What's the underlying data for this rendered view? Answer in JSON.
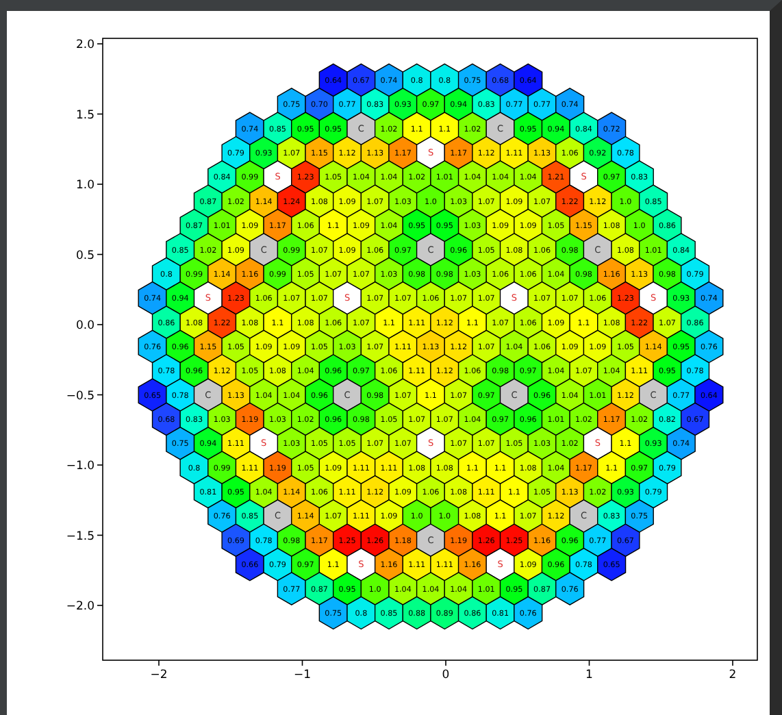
{
  "plot": {
    "y_ticks": [
      "2.0",
      "1.5",
      "1.0",
      "0.5",
      "0.0",
      "−0.5",
      "−1.0",
      "−1.5",
      "−2.0"
    ],
    "x_ticks": [
      "−2",
      "−1",
      "0",
      "1",
      "2"
    ],
    "rows": [
      {
        "cells": [
          {
            "kind": "value",
            "text": "0.64"
          },
          {
            "kind": "value",
            "text": "0.67"
          },
          {
            "kind": "value",
            "text": "0.74"
          },
          {
            "kind": "value",
            "text": "0.8"
          },
          {
            "kind": "value",
            "text": "0.8"
          },
          {
            "kind": "value",
            "text": "0.75"
          },
          {
            "kind": "value",
            "text": "0.68"
          },
          {
            "kind": "value",
            "text": "0.64"
          }
        ]
      },
      {
        "cells": [
          {
            "kind": "value",
            "text": "0.75"
          },
          {
            "kind": "value",
            "text": "0.70"
          },
          {
            "kind": "value",
            "text": "0.77"
          },
          {
            "kind": "value",
            "text": "0.83"
          },
          {
            "kind": "value",
            "text": "0.93"
          },
          {
            "kind": "value",
            "text": "0.97"
          },
          {
            "kind": "value",
            "text": "0.94"
          },
          {
            "kind": "value",
            "text": "0.83"
          },
          {
            "kind": "value",
            "text": "0.77"
          },
          {
            "kind": "value",
            "text": "0.77"
          },
          {
            "kind": "value",
            "text": "0.74"
          }
        ]
      },
      {
        "cells": [
          {
            "kind": "value",
            "text": "0.74"
          },
          {
            "kind": "value",
            "text": "0.85"
          },
          {
            "kind": "value",
            "text": "0.95"
          },
          {
            "kind": "value",
            "text": "0.95"
          },
          {
            "kind": "control",
            "text": "C"
          },
          {
            "kind": "value",
            "text": "1.02"
          },
          {
            "kind": "value",
            "text": "1.1"
          },
          {
            "kind": "value",
            "text": "1.1"
          },
          {
            "kind": "value",
            "text": "1.02"
          },
          {
            "kind": "control",
            "text": "C"
          },
          {
            "kind": "value",
            "text": "0.95"
          },
          {
            "kind": "value",
            "text": "0.94"
          },
          {
            "kind": "value",
            "text": "0.84"
          },
          {
            "kind": "value",
            "text": "0.72"
          }
        ]
      },
      {
        "cells": [
          {
            "kind": "value",
            "text": "0.79"
          },
          {
            "kind": "value",
            "text": "0.93"
          },
          {
            "kind": "value",
            "text": "1.07"
          },
          {
            "kind": "value",
            "text": "1.15"
          },
          {
            "kind": "value",
            "text": "1.12"
          },
          {
            "kind": "value",
            "text": "1.13"
          },
          {
            "kind": "value",
            "text": "1.17"
          },
          {
            "kind": "source",
            "text": "S"
          },
          {
            "kind": "value",
            "text": "1.17"
          },
          {
            "kind": "value",
            "text": "1.12"
          },
          {
            "kind": "value",
            "text": "1.11"
          },
          {
            "kind": "value",
            "text": "1.13"
          },
          {
            "kind": "value",
            "text": "1.06"
          },
          {
            "kind": "value",
            "text": "0.92"
          },
          {
            "kind": "value",
            "text": "0.78"
          }
        ]
      },
      {
        "cells": [
          {
            "kind": "value",
            "text": "0.84"
          },
          {
            "kind": "value",
            "text": "0.99"
          },
          {
            "kind": "source",
            "text": "S"
          },
          {
            "kind": "value",
            "text": "1.23"
          },
          {
            "kind": "value",
            "text": "1.05"
          },
          {
            "kind": "value",
            "text": "1.04"
          },
          {
            "kind": "value",
            "text": "1.04"
          },
          {
            "kind": "value",
            "text": "1.02"
          },
          {
            "kind": "value",
            "text": "1.01"
          },
          {
            "kind": "value",
            "text": "1.04"
          },
          {
            "kind": "value",
            "text": "1.04"
          },
          {
            "kind": "value",
            "text": "1.04"
          },
          {
            "kind": "value",
            "text": "1.21"
          },
          {
            "kind": "source",
            "text": "S"
          },
          {
            "kind": "value",
            "text": "0.97"
          },
          {
            "kind": "value",
            "text": "0.83"
          }
        ]
      },
      {
        "cells": [
          {
            "kind": "value",
            "text": "0.87"
          },
          {
            "kind": "value",
            "text": "1.02"
          },
          {
            "kind": "value",
            "text": "1.14"
          },
          {
            "kind": "value",
            "text": "1.24"
          },
          {
            "kind": "value",
            "text": "1.08"
          },
          {
            "kind": "value",
            "text": "1.09"
          },
          {
            "kind": "value",
            "text": "1.07"
          },
          {
            "kind": "value",
            "text": "1.03"
          },
          {
            "kind": "value",
            "text": "1.0"
          },
          {
            "kind": "value",
            "text": "1.03"
          },
          {
            "kind": "value",
            "text": "1.07"
          },
          {
            "kind": "value",
            "text": "1.09"
          },
          {
            "kind": "value",
            "text": "1.07"
          },
          {
            "kind": "value",
            "text": "1.22"
          },
          {
            "kind": "value",
            "text": "1.12"
          },
          {
            "kind": "value",
            "text": "1.0"
          },
          {
            "kind": "value",
            "text": "0.85"
          }
        ]
      },
      {
        "cells": [
          {
            "kind": "value",
            "text": "0.87"
          },
          {
            "kind": "value",
            "text": "1.01"
          },
          {
            "kind": "value",
            "text": "1.09"
          },
          {
            "kind": "value",
            "text": "1.17"
          },
          {
            "kind": "value",
            "text": "1.06"
          },
          {
            "kind": "value",
            "text": "1.1"
          },
          {
            "kind": "value",
            "text": "1.09"
          },
          {
            "kind": "value",
            "text": "1.04"
          },
          {
            "kind": "value",
            "text": "0.95"
          },
          {
            "kind": "value",
            "text": "0.95"
          },
          {
            "kind": "value",
            "text": "1.03"
          },
          {
            "kind": "value",
            "text": "1.09"
          },
          {
            "kind": "value",
            "text": "1.09"
          },
          {
            "kind": "value",
            "text": "1.05"
          },
          {
            "kind": "value",
            "text": "1.15"
          },
          {
            "kind": "value",
            "text": "1.08"
          },
          {
            "kind": "value",
            "text": "1.0"
          },
          {
            "kind": "value",
            "text": "0.86"
          }
        ]
      },
      {
        "cells": [
          {
            "kind": "value",
            "text": "0.85"
          },
          {
            "kind": "value",
            "text": "1.02"
          },
          {
            "kind": "value",
            "text": "1.09"
          },
          {
            "kind": "control",
            "text": "C"
          },
          {
            "kind": "value",
            "text": "0.99"
          },
          {
            "kind": "value",
            "text": "1.07"
          },
          {
            "kind": "value",
            "text": "1.09"
          },
          {
            "kind": "value",
            "text": "1.06"
          },
          {
            "kind": "value",
            "text": "0.97"
          },
          {
            "kind": "control",
            "text": "C"
          },
          {
            "kind": "value",
            "text": "0.96"
          },
          {
            "kind": "value",
            "text": "1.05"
          },
          {
            "kind": "value",
            "text": "1.08"
          },
          {
            "kind": "value",
            "text": "1.06"
          },
          {
            "kind": "value",
            "text": "0.98"
          },
          {
            "kind": "control",
            "text": "C"
          },
          {
            "kind": "value",
            "text": "1.08"
          },
          {
            "kind": "value",
            "text": "1.01"
          },
          {
            "kind": "value",
            "text": "0.84"
          }
        ]
      },
      {
        "cells": [
          {
            "kind": "value",
            "text": "0.8"
          },
          {
            "kind": "value",
            "text": "0.99"
          },
          {
            "kind": "value",
            "text": "1.14"
          },
          {
            "kind": "value",
            "text": "1.16"
          },
          {
            "kind": "value",
            "text": "0.99"
          },
          {
            "kind": "value",
            "text": "1.05"
          },
          {
            "kind": "value",
            "text": "1.07"
          },
          {
            "kind": "value",
            "text": "1.07"
          },
          {
            "kind": "value",
            "text": "1.03"
          },
          {
            "kind": "value",
            "text": "0.98"
          },
          {
            "kind": "value",
            "text": "0.98"
          },
          {
            "kind": "value",
            "text": "1.03"
          },
          {
            "kind": "value",
            "text": "1.06"
          },
          {
            "kind": "value",
            "text": "1.06"
          },
          {
            "kind": "value",
            "text": "1.04"
          },
          {
            "kind": "value",
            "text": "0.98"
          },
          {
            "kind": "value",
            "text": "1.16"
          },
          {
            "kind": "value",
            "text": "1.13"
          },
          {
            "kind": "value",
            "text": "0.98"
          },
          {
            "kind": "value",
            "text": "0.79"
          }
        ]
      },
      {
        "cells": [
          {
            "kind": "value",
            "text": "0.74"
          },
          {
            "kind": "value",
            "text": "0.94"
          },
          {
            "kind": "source",
            "text": "S"
          },
          {
            "kind": "value",
            "text": "1.23"
          },
          {
            "kind": "value",
            "text": "1.06"
          },
          {
            "kind": "value",
            "text": "1.07"
          },
          {
            "kind": "value",
            "text": "1.07"
          },
          {
            "kind": "source",
            "text": "S"
          },
          {
            "kind": "value",
            "text": "1.07"
          },
          {
            "kind": "value",
            "text": "1.07"
          },
          {
            "kind": "value",
            "text": "1.06"
          },
          {
            "kind": "value",
            "text": "1.07"
          },
          {
            "kind": "value",
            "text": "1.07"
          },
          {
            "kind": "source",
            "text": "S"
          },
          {
            "kind": "value",
            "text": "1.07"
          },
          {
            "kind": "value",
            "text": "1.07"
          },
          {
            "kind": "value",
            "text": "1.06"
          },
          {
            "kind": "value",
            "text": "1.23"
          },
          {
            "kind": "source",
            "text": "S"
          },
          {
            "kind": "value",
            "text": "0.93"
          },
          {
            "kind": "value",
            "text": "0.74"
          }
        ]
      },
      {
        "cells": [
          {
            "kind": "value",
            "text": "0.86"
          },
          {
            "kind": "value",
            "text": "1.08"
          },
          {
            "kind": "value",
            "text": "1.22"
          },
          {
            "kind": "value",
            "text": "1.08"
          },
          {
            "kind": "value",
            "text": "1.1"
          },
          {
            "kind": "value",
            "text": "1.08"
          },
          {
            "kind": "value",
            "text": "1.06"
          },
          {
            "kind": "value",
            "text": "1.07"
          },
          {
            "kind": "value",
            "text": "1.1"
          },
          {
            "kind": "value",
            "text": "1.11"
          },
          {
            "kind": "value",
            "text": "1.12"
          },
          {
            "kind": "value",
            "text": "1.1"
          },
          {
            "kind": "value",
            "text": "1.07"
          },
          {
            "kind": "value",
            "text": "1.06"
          },
          {
            "kind": "value",
            "text": "1.09"
          },
          {
            "kind": "value",
            "text": "1.1"
          },
          {
            "kind": "value",
            "text": "1.08"
          },
          {
            "kind": "value",
            "text": "1.22"
          },
          {
            "kind": "value",
            "text": "1.07"
          },
          {
            "kind": "value",
            "text": "0.86"
          }
        ]
      },
      {
        "cells": [
          {
            "kind": "value",
            "text": "0.76"
          },
          {
            "kind": "value",
            "text": "0.96"
          },
          {
            "kind": "value",
            "text": "1.15"
          },
          {
            "kind": "value",
            "text": "1.05"
          },
          {
            "kind": "value",
            "text": "1.09"
          },
          {
            "kind": "value",
            "text": "1.09"
          },
          {
            "kind": "value",
            "text": "1.05"
          },
          {
            "kind": "value",
            "text": "1.03"
          },
          {
            "kind": "value",
            "text": "1.07"
          },
          {
            "kind": "value",
            "text": "1.11"
          },
          {
            "kind": "value",
            "text": "1.13"
          },
          {
            "kind": "value",
            "text": "1.12"
          },
          {
            "kind": "value",
            "text": "1.07"
          },
          {
            "kind": "value",
            "text": "1.04"
          },
          {
            "kind": "value",
            "text": "1.06"
          },
          {
            "kind": "value",
            "text": "1.09"
          },
          {
            "kind": "value",
            "text": "1.09"
          },
          {
            "kind": "value",
            "text": "1.05"
          },
          {
            "kind": "value",
            "text": "1.14"
          },
          {
            "kind": "value",
            "text": "0.95"
          },
          {
            "kind": "value",
            "text": "0.76"
          }
        ]
      },
      {
        "cells": [
          {
            "kind": "value",
            "text": "0.78"
          },
          {
            "kind": "value",
            "text": "0.96"
          },
          {
            "kind": "value",
            "text": "1.12"
          },
          {
            "kind": "value",
            "text": "1.05"
          },
          {
            "kind": "value",
            "text": "1.08"
          },
          {
            "kind": "value",
            "text": "1.04"
          },
          {
            "kind": "value",
            "text": "0.96"
          },
          {
            "kind": "value",
            "text": "0.97"
          },
          {
            "kind": "value",
            "text": "1.06"
          },
          {
            "kind": "value",
            "text": "1.11"
          },
          {
            "kind": "value",
            "text": "1.12"
          },
          {
            "kind": "value",
            "text": "1.06"
          },
          {
            "kind": "value",
            "text": "0.98"
          },
          {
            "kind": "value",
            "text": "0.97"
          },
          {
            "kind": "value",
            "text": "1.04"
          },
          {
            "kind": "value",
            "text": "1.07"
          },
          {
            "kind": "value",
            "text": "1.04"
          },
          {
            "kind": "value",
            "text": "1.11"
          },
          {
            "kind": "value",
            "text": "0.95"
          },
          {
            "kind": "value",
            "text": "0.78"
          }
        ]
      },
      {
        "cells": [
          {
            "kind": "value",
            "text": "0.65"
          },
          {
            "kind": "value",
            "text": "0.78"
          },
          {
            "kind": "control",
            "text": "C"
          },
          {
            "kind": "value",
            "text": "1.13"
          },
          {
            "kind": "value",
            "text": "1.04"
          },
          {
            "kind": "value",
            "text": "1.04"
          },
          {
            "kind": "value",
            "text": "0.96"
          },
          {
            "kind": "control",
            "text": "C"
          },
          {
            "kind": "value",
            "text": "0.98"
          },
          {
            "kind": "value",
            "text": "1.07"
          },
          {
            "kind": "value",
            "text": "1.1"
          },
          {
            "kind": "value",
            "text": "1.07"
          },
          {
            "kind": "value",
            "text": "0.97"
          },
          {
            "kind": "control",
            "text": "C"
          },
          {
            "kind": "value",
            "text": "0.96"
          },
          {
            "kind": "value",
            "text": "1.04"
          },
          {
            "kind": "value",
            "text": "1.01"
          },
          {
            "kind": "value",
            "text": "1.12"
          },
          {
            "kind": "control",
            "text": "C"
          },
          {
            "kind": "value",
            "text": "0.77"
          },
          {
            "kind": "value",
            "text": "0.64"
          }
        ]
      },
      {
        "cells": [
          {
            "kind": "value",
            "text": "0.68"
          },
          {
            "kind": "value",
            "text": "0.83"
          },
          {
            "kind": "value",
            "text": "1.03"
          },
          {
            "kind": "value",
            "text": "1.19"
          },
          {
            "kind": "value",
            "text": "1.03"
          },
          {
            "kind": "value",
            "text": "1.02"
          },
          {
            "kind": "value",
            "text": "0.96"
          },
          {
            "kind": "value",
            "text": "0.98"
          },
          {
            "kind": "value",
            "text": "1.05"
          },
          {
            "kind": "value",
            "text": "1.07"
          },
          {
            "kind": "value",
            "text": "1.07"
          },
          {
            "kind": "value",
            "text": "1.04"
          },
          {
            "kind": "value",
            "text": "0.97"
          },
          {
            "kind": "value",
            "text": "0.96"
          },
          {
            "kind": "value",
            "text": "1.01"
          },
          {
            "kind": "value",
            "text": "1.02"
          },
          {
            "kind": "value",
            "text": "1.17"
          },
          {
            "kind": "value",
            "text": "1.02"
          },
          {
            "kind": "value",
            "text": "0.82"
          },
          {
            "kind": "value",
            "text": "0.67"
          }
        ]
      },
      {
        "cells": [
          {
            "kind": "value",
            "text": "0.75"
          },
          {
            "kind": "value",
            "text": "0.94"
          },
          {
            "kind": "value",
            "text": "1.11"
          },
          {
            "kind": "source",
            "text": "S"
          },
          {
            "kind": "value",
            "text": "1.03"
          },
          {
            "kind": "value",
            "text": "1.05"
          },
          {
            "kind": "value",
            "text": "1.05"
          },
          {
            "kind": "value",
            "text": "1.07"
          },
          {
            "kind": "value",
            "text": "1.07"
          },
          {
            "kind": "source",
            "text": "S"
          },
          {
            "kind": "value",
            "text": "1.07"
          },
          {
            "kind": "value",
            "text": "1.07"
          },
          {
            "kind": "value",
            "text": "1.05"
          },
          {
            "kind": "value",
            "text": "1.03"
          },
          {
            "kind": "value",
            "text": "1.02"
          },
          {
            "kind": "source",
            "text": "S"
          },
          {
            "kind": "value",
            "text": "1.1"
          },
          {
            "kind": "value",
            "text": "0.93"
          },
          {
            "kind": "value",
            "text": "0.74"
          }
        ]
      },
      {
        "cells": [
          {
            "kind": "value",
            "text": "0.8"
          },
          {
            "kind": "value",
            "text": "0.99"
          },
          {
            "kind": "value",
            "text": "1.11"
          },
          {
            "kind": "value",
            "text": "1.19"
          },
          {
            "kind": "value",
            "text": "1.05"
          },
          {
            "kind": "value",
            "text": "1.09"
          },
          {
            "kind": "value",
            "text": "1.11"
          },
          {
            "kind": "value",
            "text": "1.11"
          },
          {
            "kind": "value",
            "text": "1.08"
          },
          {
            "kind": "value",
            "text": "1.08"
          },
          {
            "kind": "value",
            "text": "1.1"
          },
          {
            "kind": "value",
            "text": "1.1"
          },
          {
            "kind": "value",
            "text": "1.08"
          },
          {
            "kind": "value",
            "text": "1.04"
          },
          {
            "kind": "value",
            "text": "1.17"
          },
          {
            "kind": "value",
            "text": "1.1"
          },
          {
            "kind": "value",
            "text": "0.97"
          },
          {
            "kind": "value",
            "text": "0.79"
          }
        ]
      },
      {
        "cells": [
          {
            "kind": "value",
            "text": "0.81"
          },
          {
            "kind": "value",
            "text": "0.95"
          },
          {
            "kind": "value",
            "text": "1.04"
          },
          {
            "kind": "value",
            "text": "1.14"
          },
          {
            "kind": "value",
            "text": "1.06"
          },
          {
            "kind": "value",
            "text": "1.11"
          },
          {
            "kind": "value",
            "text": "1.12"
          },
          {
            "kind": "value",
            "text": "1.09"
          },
          {
            "kind": "value",
            "text": "1.06"
          },
          {
            "kind": "value",
            "text": "1.08"
          },
          {
            "kind": "value",
            "text": "1.11"
          },
          {
            "kind": "value",
            "text": "1.1"
          },
          {
            "kind": "value",
            "text": "1.05"
          },
          {
            "kind": "value",
            "text": "1.13"
          },
          {
            "kind": "value",
            "text": "1.02"
          },
          {
            "kind": "value",
            "text": "0.93"
          },
          {
            "kind": "value",
            "text": "0.79"
          }
        ]
      },
      {
        "cells": [
          {
            "kind": "value",
            "text": "0.76"
          },
          {
            "kind": "value",
            "text": "0.85"
          },
          {
            "kind": "control",
            "text": "C"
          },
          {
            "kind": "value",
            "text": "1.14"
          },
          {
            "kind": "value",
            "text": "1.07"
          },
          {
            "kind": "value",
            "text": "1.11"
          },
          {
            "kind": "value",
            "text": "1.09"
          },
          {
            "kind": "value",
            "text": "1.0"
          },
          {
            "kind": "value",
            "text": "1.0"
          },
          {
            "kind": "value",
            "text": "1.08"
          },
          {
            "kind": "value",
            "text": "1.1"
          },
          {
            "kind": "value",
            "text": "1.07"
          },
          {
            "kind": "value",
            "text": "1.12"
          },
          {
            "kind": "control",
            "text": "C"
          },
          {
            "kind": "value",
            "text": "0.83"
          },
          {
            "kind": "value",
            "text": "0.75"
          }
        ]
      },
      {
        "cells": [
          {
            "kind": "value",
            "text": "0.69"
          },
          {
            "kind": "value",
            "text": "0.78"
          },
          {
            "kind": "value",
            "text": "0.98"
          },
          {
            "kind": "value",
            "text": "1.17"
          },
          {
            "kind": "value",
            "text": "1.25"
          },
          {
            "kind": "value",
            "text": "1.26"
          },
          {
            "kind": "value",
            "text": "1.18"
          },
          {
            "kind": "control",
            "text": "C"
          },
          {
            "kind": "value",
            "text": "1.19"
          },
          {
            "kind": "value",
            "text": "1.26"
          },
          {
            "kind": "value",
            "text": "1.25"
          },
          {
            "kind": "value",
            "text": "1.16"
          },
          {
            "kind": "value",
            "text": "0.96"
          },
          {
            "kind": "value",
            "text": "0.77"
          },
          {
            "kind": "value",
            "text": "0.67"
          }
        ]
      },
      {
        "cells": [
          {
            "kind": "value",
            "text": "0.66"
          },
          {
            "kind": "value",
            "text": "0.79"
          },
          {
            "kind": "value",
            "text": "0.97"
          },
          {
            "kind": "value",
            "text": "1.1"
          },
          {
            "kind": "source",
            "text": "S"
          },
          {
            "kind": "value",
            "text": "1.16"
          },
          {
            "kind": "value",
            "text": "1.11"
          },
          {
            "kind": "value",
            "text": "1.11"
          },
          {
            "kind": "value",
            "text": "1.16"
          },
          {
            "kind": "source",
            "text": "S"
          },
          {
            "kind": "value",
            "text": "1.09"
          },
          {
            "kind": "value",
            "text": "0.96"
          },
          {
            "kind": "value",
            "text": "0.78"
          },
          {
            "kind": "value",
            "text": "0.65"
          }
        ]
      },
      {
        "cells": [
          {
            "kind": "value",
            "text": "0.77"
          },
          {
            "kind": "value",
            "text": "0.87"
          },
          {
            "kind": "value",
            "text": "0.95"
          },
          {
            "kind": "value",
            "text": "1.0"
          },
          {
            "kind": "value",
            "text": "1.04"
          },
          {
            "kind": "value",
            "text": "1.04"
          },
          {
            "kind": "value",
            "text": "1.04"
          },
          {
            "kind": "value",
            "text": "1.01"
          },
          {
            "kind": "value",
            "text": "0.95"
          },
          {
            "kind": "value",
            "text": "0.87"
          },
          {
            "kind": "value",
            "text": "0.76"
          }
        ]
      },
      {
        "cells": [
          {
            "kind": "value",
            "text": "0.75"
          },
          {
            "kind": "value",
            "text": "0.8"
          },
          {
            "kind": "value",
            "text": "0.85"
          },
          {
            "kind": "value",
            "text": "0.88"
          },
          {
            "kind": "value",
            "text": "0.89"
          },
          {
            "kind": "value",
            "text": "0.86"
          },
          {
            "kind": "value",
            "text": "0.81"
          },
          {
            "kind": "value",
            "text": "0.76"
          }
        ]
      }
    ]
  }
}
